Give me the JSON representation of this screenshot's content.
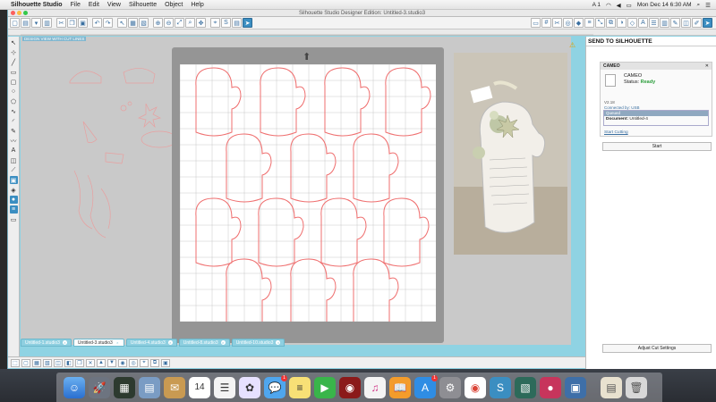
{
  "menubar": {
    "app": "Silhouette Studio",
    "items": [
      "File",
      "Edit",
      "View",
      "Silhouette",
      "Object",
      "Help"
    ],
    "clock": "Mon Dec 14  6:30 AM",
    "input_badge": "A 1"
  },
  "window": {
    "title": "Silhouette Studio Designer Edition: Untitled-3.studio3",
    "design_label": "DESIGN VIEW WITH CUT LINES"
  },
  "tabs": [
    {
      "label": "Untitled-1.studio3",
      "active": false
    },
    {
      "label": "Untitled-3.studio3",
      "active": true
    },
    {
      "label": "Untitled-4.studio3",
      "active": false
    },
    {
      "label": "Untitled-8.studio3",
      "active": false
    },
    {
      "label": "Untitled-10.studio3",
      "active": false
    }
  ],
  "panel": {
    "title": "SEND TO SILHOUETTE",
    "device_header": "CAMEO",
    "device_name": "CAMEO",
    "status_label": "Status:",
    "status_value": "Ready",
    "version": "V2.18",
    "connected": "Connected by: USB",
    "queue_header": "Queued",
    "document_label": "Document:",
    "document_value": "Untitled-4",
    "start_cutting": "Start Cutting",
    "start_button": "Start",
    "adjust_button": "Adjust Cut Settings"
  },
  "colors": {
    "accent": "#3b8ec1",
    "window_bg": "#8fd3e3",
    "cut_line": "#ef6f6f",
    "status_ready": "#2a9d3a"
  },
  "icons": {
    "dock": [
      "finder-icon",
      "launchpad-icon",
      "mission-control-icon",
      "preview-icon",
      "mail-icon",
      "calendar-icon",
      "reminders-icon",
      "photos-icon",
      "messages-icon",
      "notes-icon",
      "facetime-icon",
      "photobooth-icon",
      "itunes-icon",
      "ibooks-icon",
      "app-store-icon",
      "system-preferences-icon",
      "chrome-icon",
      "silhouette-icon",
      "photo-icon",
      "game-icon",
      "preview2-icon",
      "document-icon",
      "trash-icon"
    ]
  },
  "dock_badges": {
    "messages": "1",
    "app_store": "1"
  },
  "calendar_day": "14"
}
